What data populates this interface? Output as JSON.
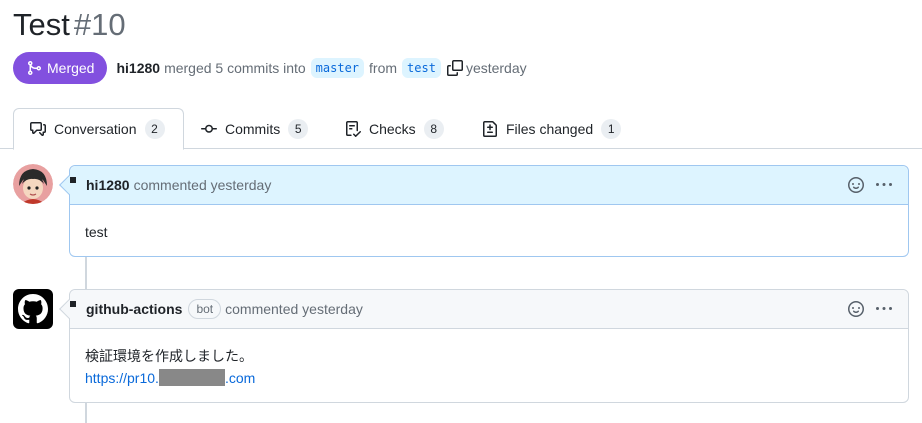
{
  "pr": {
    "title": "Test",
    "number": "#10",
    "state": "Merged",
    "author": "hi1280",
    "merge_text": "merged 5 commits into",
    "base_branch": "master",
    "from_text": "from",
    "head_branch": "test",
    "time": "yesterday"
  },
  "tabs": [
    {
      "label": "Conversation",
      "count": "2",
      "icon": "comment-discussion-icon"
    },
    {
      "label": "Commits",
      "count": "5",
      "icon": "git-commit-icon"
    },
    {
      "label": "Checks",
      "count": "8",
      "icon": "checklist-icon"
    },
    {
      "label": "Files changed",
      "count": "1",
      "icon": "file-diff-icon"
    }
  ],
  "comments": [
    {
      "author": "hi1280",
      "action": "commented yesterday",
      "body": "test"
    },
    {
      "author": "github-actions",
      "badge": "bot",
      "action": "commented yesterday",
      "body_line1": "検証環境を作成しました。",
      "link_prefix": "https://pr10.",
      "link_suffix": ".com"
    }
  ],
  "colors": {
    "merged": "#8250df",
    "link": "#0969da",
    "owner_header": "#ddf4ff"
  }
}
